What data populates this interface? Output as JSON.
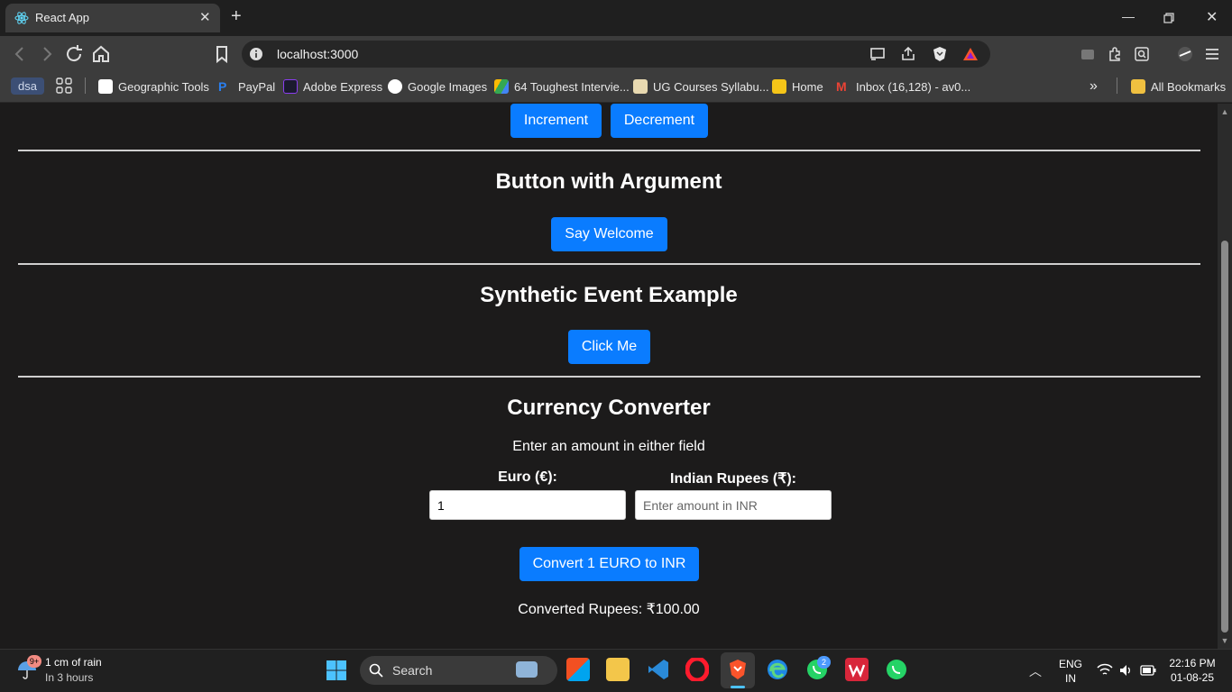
{
  "browser": {
    "tab_title": "React App",
    "url": "localhost:3000",
    "bookmarks": [
      {
        "label": "dsa"
      },
      {
        "label": "Geographic Tools"
      },
      {
        "label": "PayPal"
      },
      {
        "label": "Adobe Express"
      },
      {
        "label": "Google Images"
      },
      {
        "label": "64 Toughest Intervie..."
      },
      {
        "label": "UG Courses Syllabu..."
      },
      {
        "label": "Home"
      },
      {
        "label": "Inbox (16,128) - av0..."
      }
    ],
    "all_bookmarks": "All Bookmarks",
    "overflow": "»"
  },
  "page": {
    "counter": {
      "increment_label": "Increment",
      "decrement_label": "Decrement"
    },
    "argument": {
      "heading": "Button with Argument",
      "button_label": "Say Welcome"
    },
    "synthetic": {
      "heading": "Synthetic Event Example",
      "button_label": "Click Me"
    },
    "currency": {
      "heading": "Currency Converter",
      "hint": "Enter an amount in either field",
      "euro_label": "Euro (€):",
      "inr_label": "Indian Rupees (₹):",
      "euro_value": "1",
      "inr_placeholder": "Enter amount in INR",
      "convert_button": "Convert 1 EURO to INR",
      "result": "Converted Rupees: ₹100.00"
    }
  },
  "taskbar": {
    "weather_title": "1 cm of rain",
    "weather_sub": "In 3 hours",
    "weather_badge": "9+",
    "search_label": "Search",
    "whatsapp_badge": "2",
    "lang_top": "ENG",
    "lang_bottom": "IN",
    "time": "22:16 PM",
    "date": "01-08-25"
  }
}
